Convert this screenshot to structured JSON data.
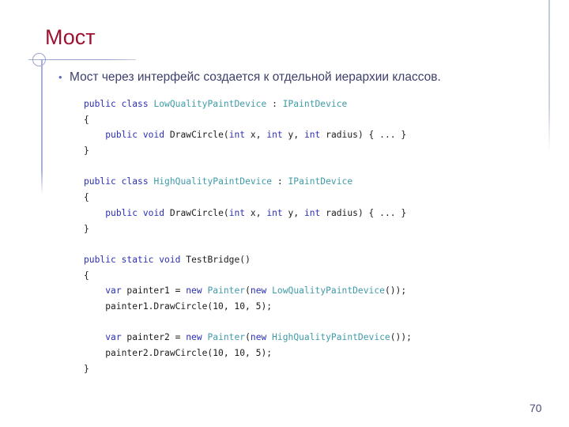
{
  "slide": {
    "title": "Мост",
    "bullet_marker": "•",
    "bullet_text": "Мост через интерфейс создается к отдельной иерархии классов.",
    "page_number": "70"
  },
  "colors": {
    "title": "#9e1131",
    "body_text": "#3d3f6b",
    "code_keyword": "#2b2fb5",
    "code_type": "#3f9ba8",
    "code_plain": "#1c1c1c",
    "rule": "#9aa3cf",
    "page_number": "#494b78"
  },
  "code": {
    "lines": [
      {
        "id": "l1",
        "tokens": [
          {
            "t": "public",
            "c": "kw"
          },
          {
            "t": " ",
            "c": "pln"
          },
          {
            "t": "class",
            "c": "kw"
          },
          {
            "t": " ",
            "c": "pln"
          },
          {
            "t": "LowQualityPaintDevice",
            "c": "type"
          },
          {
            "t": " : ",
            "c": "pln"
          },
          {
            "t": "IPaintDevice",
            "c": "type"
          }
        ]
      },
      {
        "id": "l2",
        "tokens": [
          {
            "t": "{",
            "c": "pln"
          }
        ]
      },
      {
        "id": "l3",
        "tokens": [
          {
            "t": "    ",
            "c": "pln"
          },
          {
            "t": "public",
            "c": "kw"
          },
          {
            "t": " ",
            "c": "pln"
          },
          {
            "t": "void",
            "c": "kw"
          },
          {
            "t": " DrawCircle(",
            "c": "pln"
          },
          {
            "t": "int",
            "c": "kw"
          },
          {
            "t": " x, ",
            "c": "pln"
          },
          {
            "t": "int",
            "c": "kw"
          },
          {
            "t": " y, ",
            "c": "pln"
          },
          {
            "t": "int",
            "c": "kw"
          },
          {
            "t": " radius) { ... }",
            "c": "pln"
          }
        ]
      },
      {
        "id": "l4",
        "tokens": [
          {
            "t": "}",
            "c": "pln"
          }
        ]
      },
      {
        "id": "l5",
        "tokens": [
          {
            "t": " ",
            "c": "pln"
          }
        ]
      },
      {
        "id": "l6",
        "tokens": [
          {
            "t": "public",
            "c": "kw"
          },
          {
            "t": " ",
            "c": "pln"
          },
          {
            "t": "class",
            "c": "kw"
          },
          {
            "t": " ",
            "c": "pln"
          },
          {
            "t": "HighQualityPaintDevice",
            "c": "type"
          },
          {
            "t": " : ",
            "c": "pln"
          },
          {
            "t": "IPaintDevice",
            "c": "type"
          }
        ]
      },
      {
        "id": "l7",
        "tokens": [
          {
            "t": "{",
            "c": "pln"
          }
        ]
      },
      {
        "id": "l8",
        "tokens": [
          {
            "t": "    ",
            "c": "pln"
          },
          {
            "t": "public",
            "c": "kw"
          },
          {
            "t": " ",
            "c": "pln"
          },
          {
            "t": "void",
            "c": "kw"
          },
          {
            "t": " DrawCircle(",
            "c": "pln"
          },
          {
            "t": "int",
            "c": "kw"
          },
          {
            "t": " x, ",
            "c": "pln"
          },
          {
            "t": "int",
            "c": "kw"
          },
          {
            "t": " y, ",
            "c": "pln"
          },
          {
            "t": "int",
            "c": "kw"
          },
          {
            "t": " radius) { ... }",
            "c": "pln"
          }
        ]
      },
      {
        "id": "l9",
        "tokens": [
          {
            "t": "}",
            "c": "pln"
          }
        ]
      },
      {
        "id": "l10",
        "tokens": [
          {
            "t": " ",
            "c": "pln"
          }
        ]
      },
      {
        "id": "l11",
        "tokens": [
          {
            "t": "public",
            "c": "kw"
          },
          {
            "t": " ",
            "c": "pln"
          },
          {
            "t": "static",
            "c": "kw"
          },
          {
            "t": " ",
            "c": "pln"
          },
          {
            "t": "void",
            "c": "kw"
          },
          {
            "t": " TestBridge()",
            "c": "pln"
          }
        ]
      },
      {
        "id": "l12",
        "tokens": [
          {
            "t": "{",
            "c": "pln"
          }
        ]
      },
      {
        "id": "l13",
        "tokens": [
          {
            "t": "    ",
            "c": "pln"
          },
          {
            "t": "var",
            "c": "kw"
          },
          {
            "t": " painter1 = ",
            "c": "pln"
          },
          {
            "t": "new",
            "c": "kw"
          },
          {
            "t": " ",
            "c": "pln"
          },
          {
            "t": "Painter",
            "c": "type"
          },
          {
            "t": "(",
            "c": "pln"
          },
          {
            "t": "new",
            "c": "kw"
          },
          {
            "t": " ",
            "c": "pln"
          },
          {
            "t": "LowQualityPaintDevice",
            "c": "type"
          },
          {
            "t": "());",
            "c": "pln"
          }
        ]
      },
      {
        "id": "l14",
        "tokens": [
          {
            "t": "    painter1.DrawCircle(10, 10, 5);",
            "c": "pln"
          }
        ]
      },
      {
        "id": "l15",
        "tokens": [
          {
            "t": " ",
            "c": "pln"
          }
        ]
      },
      {
        "id": "l16",
        "tokens": [
          {
            "t": "    ",
            "c": "pln"
          },
          {
            "t": "var",
            "c": "kw"
          },
          {
            "t": " painter2 = ",
            "c": "pln"
          },
          {
            "t": "new",
            "c": "kw"
          },
          {
            "t": " ",
            "c": "pln"
          },
          {
            "t": "Painter",
            "c": "type"
          },
          {
            "t": "(",
            "c": "pln"
          },
          {
            "t": "new",
            "c": "kw"
          },
          {
            "t": " ",
            "c": "pln"
          },
          {
            "t": "HighQualityPaintDevice",
            "c": "type"
          },
          {
            "t": "());",
            "c": "pln"
          }
        ]
      },
      {
        "id": "l17",
        "tokens": [
          {
            "t": "    painter2.DrawCircle(10, 10, 5);",
            "c": "pln"
          }
        ]
      },
      {
        "id": "l18",
        "tokens": [
          {
            "t": "}",
            "c": "pln"
          }
        ]
      }
    ]
  }
}
